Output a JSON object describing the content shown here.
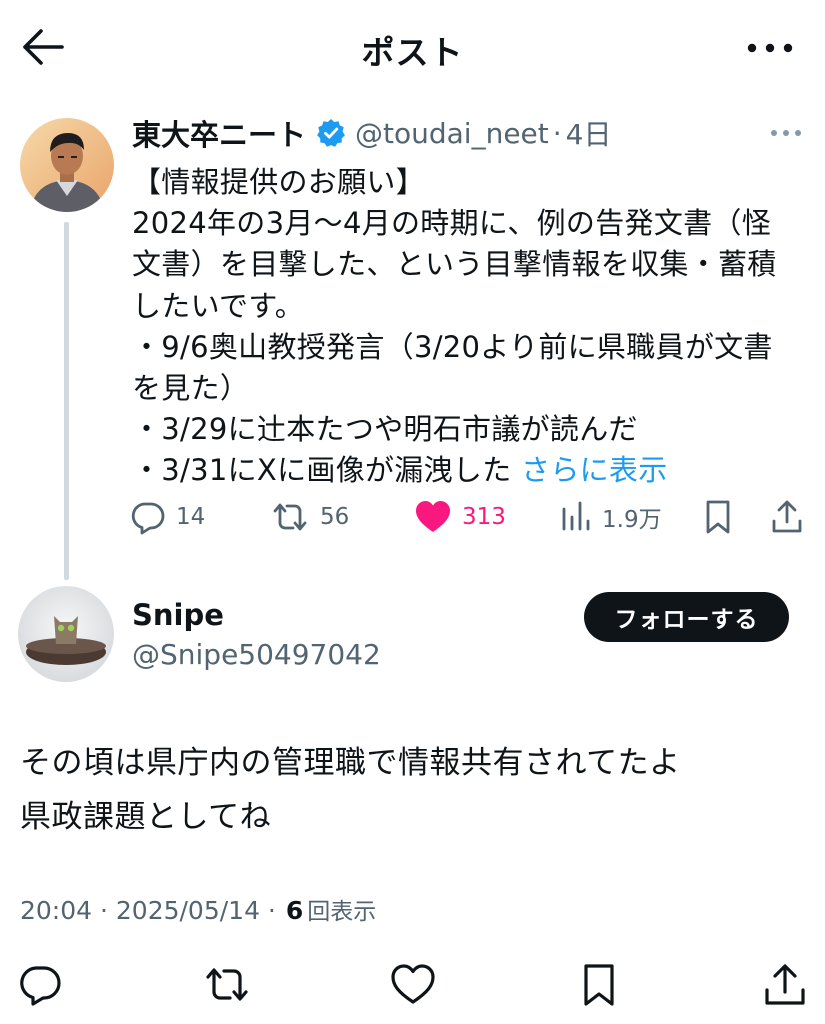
{
  "header": {
    "title": "ポスト"
  },
  "parent_post": {
    "author_name": "東大卒ニート",
    "handle": "@toudai_neet",
    "separator": "·",
    "time": "4日",
    "text_lines": [
      "【情報提供のお願い】",
      "2024年の3月～4月の時期に、例の告発文書（怪",
      "文書）を目撃した、という目撃情報を収集・蓄積",
      "したいです。",
      "・9/6奥山教授発言（3/20より前に県職員が文書",
      "を見た）",
      "・3/29に辻本たつや明石市議が読んだ",
      "・3/31にXに画像が漏洩した"
    ],
    "show_more": "さらに表示",
    "stats": {
      "replies": "14",
      "reposts": "56",
      "likes": "313",
      "views": "1.9万"
    },
    "colors": {
      "like": "#f91880",
      "verified": "#1d9bf0",
      "link": "#1d9bf0"
    },
    "icons": [
      "reply-icon",
      "repost-icon",
      "heart-filled-icon",
      "views-chart-icon",
      "bookmark-icon",
      "share-icon"
    ]
  },
  "reply_post": {
    "author_name": "Snipe",
    "handle": "@Snipe50497042",
    "follow_label": "フォローする",
    "text_lines": [
      "その頃は県庁内の管理職で情報共有されてたよ",
      "県政課題としてね"
    ],
    "meta": {
      "time": "20:04",
      "separator": " · ",
      "date": "2025/05/14",
      "views_count": "6",
      "views_label": "回表示"
    }
  },
  "bottom_actions": [
    "reply-icon",
    "repost-icon",
    "heart-icon",
    "bookmark-icon",
    "share-icon"
  ]
}
